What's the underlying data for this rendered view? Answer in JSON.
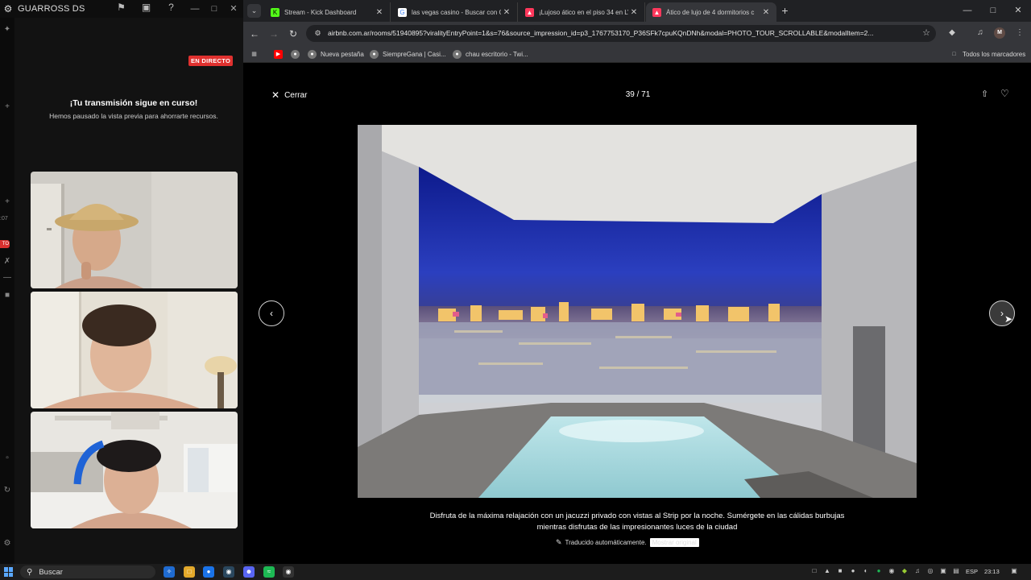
{
  "left_app": {
    "title": "GUARROSS DS",
    "live_badge": "EN DIRECTO",
    "message_title": "¡Tu transmisión sigue en curso!",
    "message_subtitle": "Hemos pausado la vista previa para ahorrarte recursos.",
    "rail_time": ":07",
    "rail_badge": "TO"
  },
  "browser": {
    "tabs": [
      {
        "label": "Stream - Kick Dashboard",
        "favicon": "kick-icon",
        "color": "#53fc18"
      },
      {
        "label": "las vegas casino - Buscar con G",
        "favicon": "google-icon",
        "color": "#ffffff"
      },
      {
        "label": "¡Lujoso ático en el piso 34 en LV",
        "favicon": "airbnb-icon",
        "color": "#ff385c"
      },
      {
        "label": "Ático de lujo de 4 dormitorios c",
        "favicon": "airbnb-icon",
        "color": "#ff385c",
        "active": true
      }
    ],
    "url": "airbnb.com.ar/rooms/51940895?viralityEntryPoint=1&s=76&source_impression_id=p3_1767753170_P36SFk7cpuKQnDNh&modal=PHOTO_TOUR_SCROLLABLE&modalItem=2...",
    "profile_initial": "M",
    "bookmarks": [
      {
        "label": "Nueva pestaña"
      },
      {
        "label": "SiempreGana | Casi..."
      },
      {
        "label": "chau escritorio - Twi..."
      }
    ],
    "all_bookmarks": "Todos los marcadores"
  },
  "viewer": {
    "close_label": "Cerrar",
    "counter": "39 / 71",
    "caption": "Disfruta de la máxima relajación con un jacuzzi privado con vistas al Strip por la noche. Sumérgete en las cálidas burbujas mientras disfrutas de las impresionantes luces de la ciudad",
    "translated_label": "Traducido automáticamente.",
    "show_original": "Mostrar original"
  },
  "taskbar": {
    "search_placeholder": "Buscar",
    "language": "ESP",
    "time": "23:13"
  },
  "colors": {
    "live_red": "#e0312f",
    "chrome_dark": "#202124",
    "chrome_toolbar": "#35363a"
  }
}
